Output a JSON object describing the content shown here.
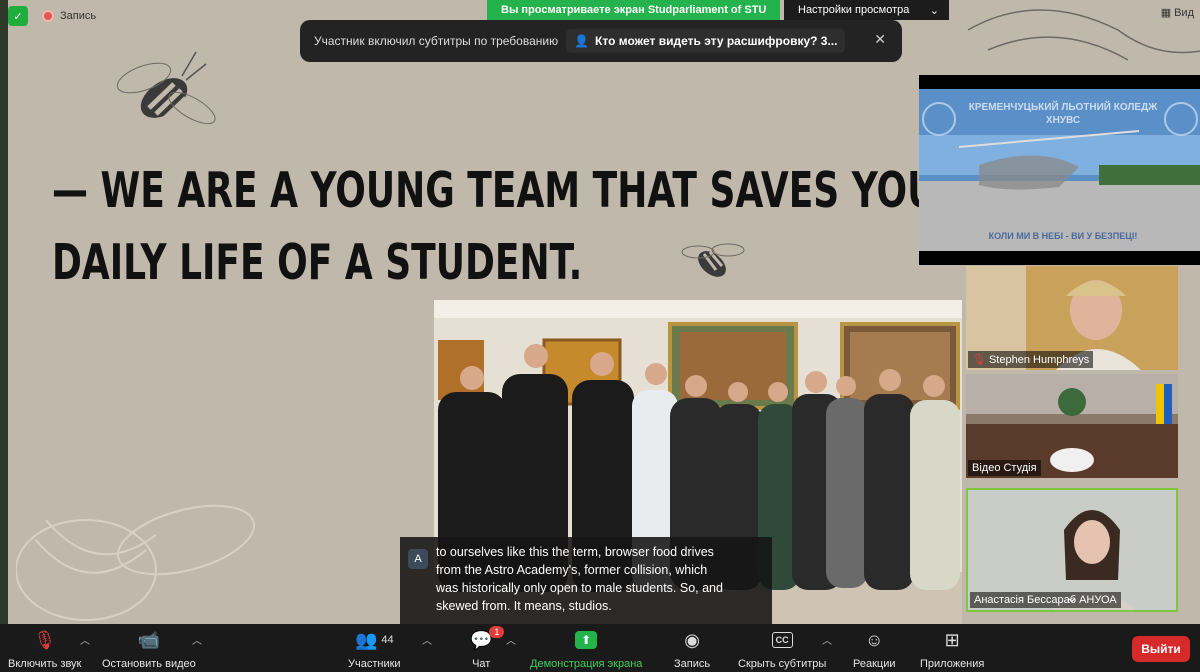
{
  "top": {
    "recording_label": "Запись",
    "share_banner": "Вы просматриваете экран Studparliament of STU",
    "view_settings": "Настройки просмотра",
    "view_button": "Вид"
  },
  "toast": {
    "message": "Участник включил субтитры по требованию",
    "link": "Кто может видеть эту расшифровку? 3..."
  },
  "slide": {
    "line1": "— WE ARE A YOUNG TEAM THAT SAVES YOU FROM A MO",
    "line2": "DAILY LIFE OF A STUDENT."
  },
  "video_main": {
    "banner_text": "КРЕМЕНЧУЦЬКИЙ ЛЬОТНИЙ КОЛЕДЖ ХНУВС",
    "footer_text": "КОЛИ МИ В НЕБІ - ВИ У БЕЗПЕЦІ!"
  },
  "tiles": [
    {
      "name": "Stephen Humphreys",
      "muted": true
    },
    {
      "name": "Відео Студія",
      "muted": false
    },
    {
      "name": "Анастасія Бессараб АНУОА",
      "muted": false
    }
  ],
  "subtitles": {
    "avatar_letter": "A",
    "text_lines": [
      "to ourselves like this the term, browser food drives",
      "from the Astro Academy's, former collision, which",
      "was historically only open to male students. So, and",
      "skewed from. It means, studios."
    ]
  },
  "toolbar": {
    "unmute": "Включить звук",
    "start_video": "Остановить видео",
    "participants": "Участники",
    "participants_count": "44",
    "chat": "Чат",
    "chat_badge": "1",
    "share": "Демонстрация экрана",
    "record": "Запись",
    "captions": "Скрыть субтитры",
    "captions_icon": "CC",
    "reactions": "Реакции",
    "apps": "Приложения",
    "leave": "Выйти"
  },
  "colors": {
    "slide_bg": "#c1b8ac",
    "share_green": "#23b24b",
    "leave_red": "#d62a2a",
    "toolbar_bg": "#1a1a1a"
  }
}
